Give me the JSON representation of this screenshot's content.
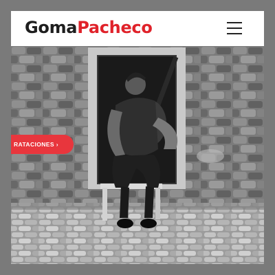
{
  "header": {
    "logo_part1": "Goma",
    "logo_part2": "Pacheco",
    "menu_icon": "hamburger-menu-icon"
  },
  "hero": {
    "cta_label": "RATACIONES ›",
    "image_description_icon": "guitarist-photo"
  },
  "colors": {
    "brand_red": "#e0222a",
    "cta_red": "#e8363d",
    "text_dark": "#1e1e1e",
    "outer_gray": "#7a7a7a"
  }
}
